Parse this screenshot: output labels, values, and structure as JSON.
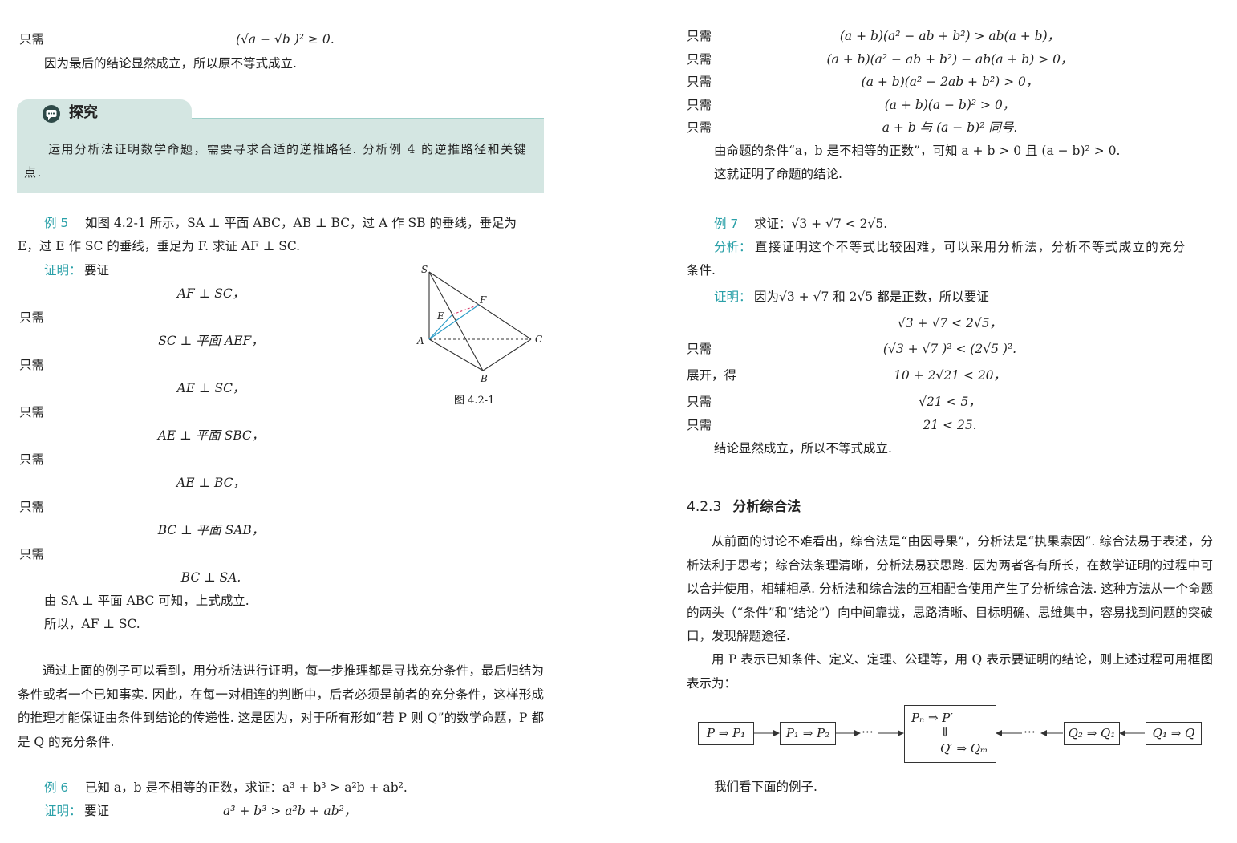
{
  "left": {
    "top_lines": [
      {
        "label": "只需",
        "formula": "(√a − √b )² ≥ 0."
      },
      {
        "text": "因为最后的结论显然成立，所以原不等式成立."
      }
    ],
    "explore": {
      "title": "探究",
      "text": "运用分析法证明数学命题，需要寻求合适的逆推路径. 分析例 4 的逆推路径和关键点."
    },
    "example5": {
      "label": "例 5",
      "line1": "如图 4.2-1 所示，SA ⊥ 平面 ABC，AB ⊥ BC，过 A 作 SB 的垂线，垂足为",
      "line2": "E，过 E 作 SC 的垂线，垂足为 F. 求证 AF ⊥ SC.",
      "proof_label": "证明：",
      "proof_start": "要证",
      "steps": [
        {
          "label": "",
          "formula": "AF ⊥ SC，"
        },
        {
          "label": "只需",
          "formula": "SC ⊥ 平面 AEF，"
        },
        {
          "label": "只需",
          "formula": "AE ⊥ SC，"
        },
        {
          "label": "只需",
          "formula": "AE ⊥ 平面 SBC，"
        },
        {
          "label": "只需",
          "formula": "AE ⊥ BC，"
        },
        {
          "label": "只需",
          "formula": "BC ⊥ 平面 SAB，"
        },
        {
          "label": "只需",
          "formula": "BC ⊥ SA."
        }
      ],
      "conclusion1": "由 SA ⊥ 平面 ABC 可知，上式成立.",
      "conclusion2": "所以，AF ⊥ SC.",
      "figure": {
        "caption": "图 4.2-1",
        "points": {
          "S": "S",
          "A": "A",
          "B": "B",
          "C": "C",
          "E": "E",
          "F": "F"
        }
      }
    },
    "summary": "通过上面的例子可以看到，用分析法进行证明，每一步推理都是寻找充分条件，最后归结为条件或者一个已知事实. 因此，在每一对相连的判断中，后者必须是前者的充分条件，这样形成的推理才能保证由条件到结论的传递性. 这是因为，对于所有形如“若 P 则 Q”的数学命题，P 都是 Q 的充分条件.",
    "example6": {
      "label": "例 6",
      "text": "已知 a，b 是不相等的正数，求证：a³ + b³ > a²b + ab².",
      "proof_label": "证明：",
      "proof_start": "要证",
      "formula": "a³ + b³ > a²b + ab²，"
    }
  },
  "right": {
    "steps": [
      {
        "label": "只需",
        "formula": "(a + b)(a² − ab + b²) > ab(a + b)，"
      },
      {
        "label": "只需",
        "formula": "(a + b)(a² − ab + b²) − ab(a + b) > 0，"
      },
      {
        "label": "只需",
        "formula": "(a + b)(a² − 2ab + b²) > 0，"
      },
      {
        "label": "只需",
        "formula": "(a + b)(a − b)² > 0，"
      },
      {
        "label": "只需",
        "formula": "a + b 与 (a − b)² 同号."
      }
    ],
    "conclusion1": "由命题的条件“a，b 是不相等的正数”，可知 a + b > 0 且 (a − b)² > 0.",
    "conclusion2": "这就证明了命题的结论.",
    "example7": {
      "label": "例 7",
      "text": "求证：√3 + √7 < 2√5.",
      "analysis_label": "分析：",
      "analysis_line1": "直接证明这个不等式比较困难，可以采用分析法，分析不等式成立的充分",
      "analysis_line2": "条件.",
      "proof_label": "证明：",
      "proof_text": "因为√3 + √7 和 2√5 都是正数，所以要证",
      "steps": [
        {
          "label": "",
          "formula": "√3 + √7 < 2√5，"
        },
        {
          "label": "只需",
          "formula": "(√3 + √7 )² < (2√5 )²."
        },
        {
          "label": "展开，得",
          "formula": "10 + 2√21 < 20，"
        },
        {
          "label": "只需",
          "formula": "√21 < 5，"
        },
        {
          "label": "只需",
          "formula": "21 < 25."
        }
      ],
      "conclusion": "结论显然成立，所以不等式成立."
    },
    "section": {
      "number": "4.2.3",
      "title": "分析综合法"
    },
    "para1": "从前面的讨论不难看出，综合法是“由因导果”，分析法是“执果索因”. 综合法易于表述，分析法利于思考；综合法条理清晰，分析法易获思路. 因为两者各有所长，在数学证明的过程中可以合并使用，相辅相承. 分析法和综合法的互相配合使用产生了分析综合法. 这种方法从一个命题的两头（“条件”和“结论”）向中间靠拢，思路清晰、目标明确、思维集中，容易找到问题的突破口，发现解题途径.",
    "para2": "用 P 表示已知条件、定义、定理、公理等，用 Q 表示要证明的结论，则上述过程可用框图表示为：",
    "flow": {
      "box1": "P ⇒ P₁",
      "box2": "P₁ ⇒ P₂",
      "dots_left": "···",
      "center_top": "Pₙ ⇒ P′",
      "center_arrow": "⇓",
      "center_bottom": "Q′ ⇒ Qₘ",
      "dots_right": "···",
      "box4": "Q₂ ⇒ Q₁",
      "box5": "Q₁ ⇒ Q"
    },
    "closing": "我们看下面的例子."
  }
}
